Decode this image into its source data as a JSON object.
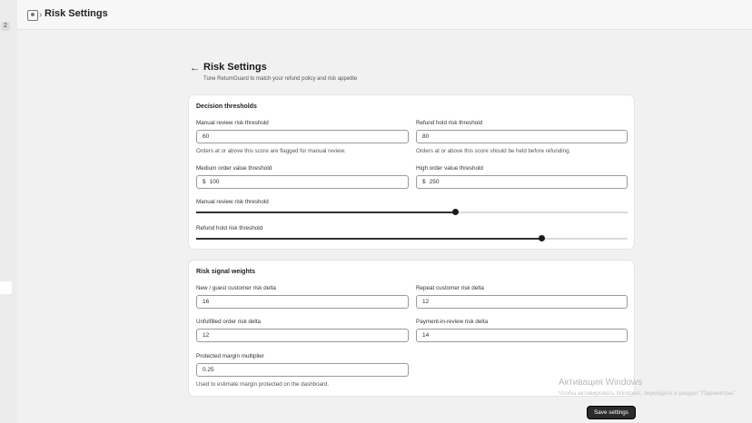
{
  "left_rail": {
    "badge": "2"
  },
  "topbar": {
    "title": "Risk Settings"
  },
  "page": {
    "title": "Risk Settings",
    "subtitle": "Tune ReturnGuard to match your refund policy and risk appetite"
  },
  "decision_thresholds": {
    "title": "Decision thresholds",
    "manual_review": {
      "label": "Manual review risk threshold",
      "value": "60",
      "help": "Orders at or above this score are flagged for manual review."
    },
    "refund_hold": {
      "label": "Refund hold risk threshold",
      "value": "80",
      "help": "Orders at or above this score should be held before refunding."
    },
    "medium_order_value": {
      "label": "Medium order value threshold",
      "prefix": "$",
      "value": "100"
    },
    "high_order_value": {
      "label": "High order value threshold",
      "prefix": "$",
      "value": "250"
    },
    "manual_review_slider": {
      "label": "Manual review risk threshold",
      "value": 60,
      "min": 0,
      "max": 100
    },
    "refund_hold_slider": {
      "label": "Refund hold risk threshold",
      "value": 80,
      "min": 0,
      "max": 100
    }
  },
  "risk_signal_weights": {
    "title": "Risk signal weights",
    "new_guest": {
      "label": "New / guest customer risk delta",
      "value": "16"
    },
    "repeat_customer": {
      "label": "Repeat customer risk delta",
      "value": "12"
    },
    "unfulfilled_order": {
      "label": "Unfulfilled order risk delta",
      "value": "12"
    },
    "payment_in_review": {
      "label": "Payment-in-review risk delta",
      "value": "14"
    },
    "protected_margin": {
      "label": "Protected margin multiplier",
      "value": "0.25",
      "help": "Used to estimate margin protected on the dashboard."
    }
  },
  "watermark": {
    "line1": "Активация Windows",
    "line2": "Чтобы активировать Windows, перейдите в раздел \"Параметры\"."
  },
  "actions": {
    "save_label": "Save settings"
  }
}
